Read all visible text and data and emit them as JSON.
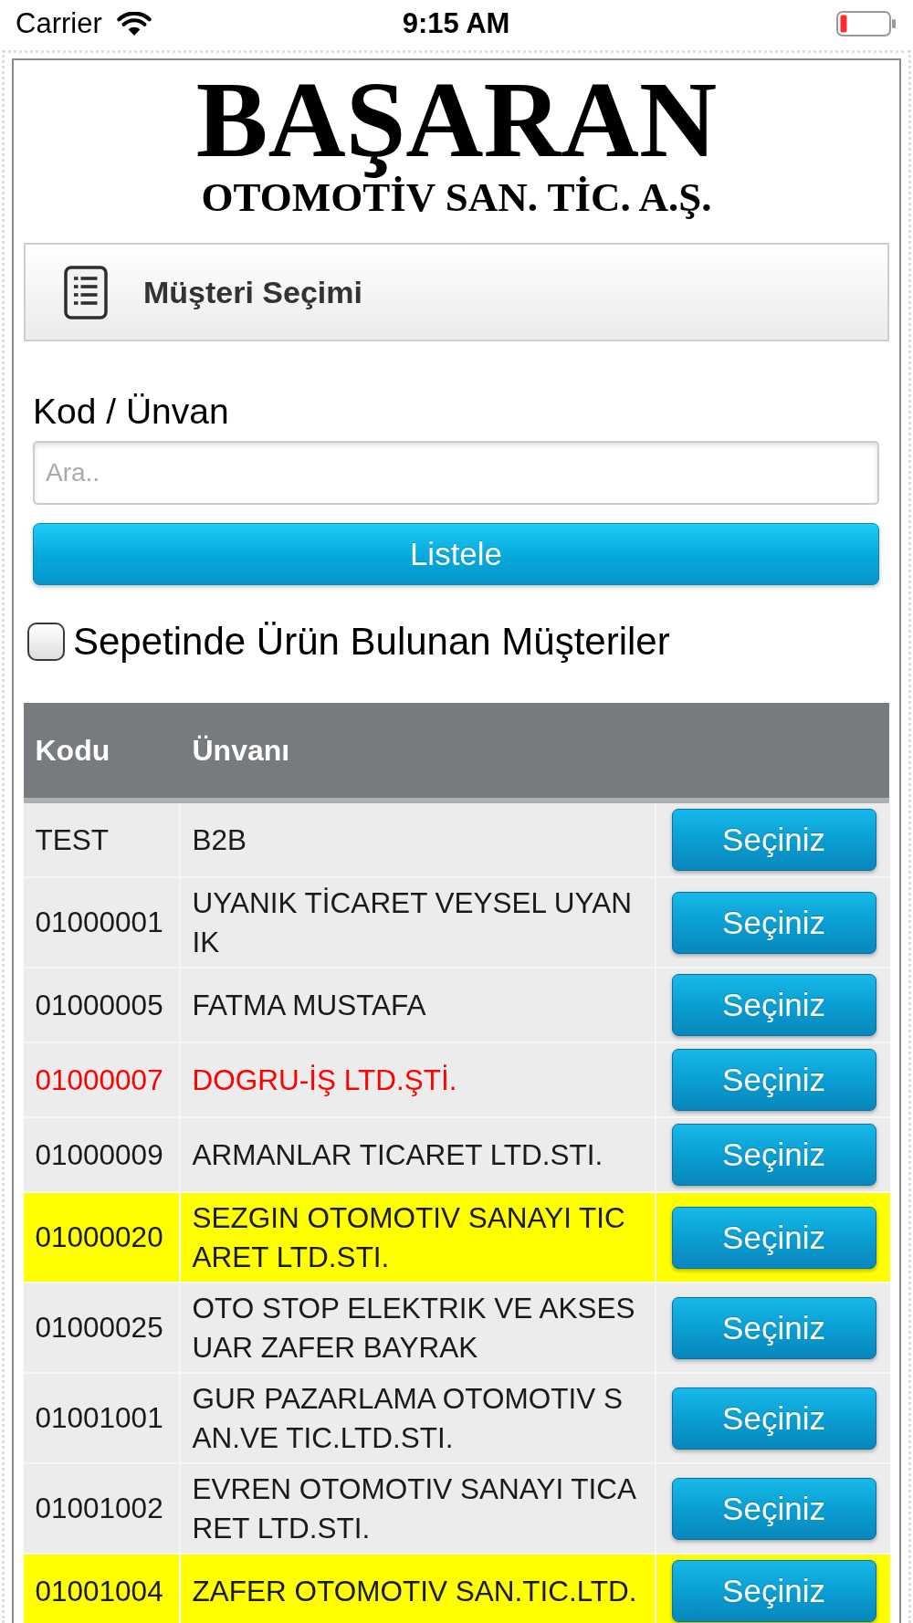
{
  "status_bar": {
    "carrier": "Carrier",
    "time": "9:15 AM"
  },
  "logo": {
    "title": "BAŞARAN",
    "subtitle": "OTOMOTİV SAN. TİC. A.Ş."
  },
  "panel": {
    "title": "Müşteri Seçimi"
  },
  "search": {
    "label": "Kod / Ünvan",
    "placeholder": "Ara..",
    "button": "Listele"
  },
  "filter": {
    "label": "Sepetinde Ürün Bulunan Müşteriler",
    "checked": false
  },
  "table": {
    "columns": [
      "Kodu",
      "Ünvanı"
    ],
    "rows": [
      {
        "code": "TEST",
        "name": "B2B",
        "button": "Seçiniz",
        "highlighted": false,
        "warning": false
      },
      {
        "code": "01000001",
        "name": "UYANIK TİCARET VEYSEL UYANIK",
        "button": "Seçiniz",
        "highlighted": false,
        "warning": false
      },
      {
        "code": "01000005",
        "name": "FATMA MUSTAFA",
        "button": "Seçiniz",
        "highlighted": false,
        "warning": false
      },
      {
        "code": "01000007",
        "name": "DOGRU-İŞ LTD.ŞTİ.",
        "button": "Seçiniz",
        "highlighted": false,
        "warning": true
      },
      {
        "code": "01000009",
        "name": "ARMANLAR TICARET LTD.STI.",
        "button": "Seçiniz",
        "highlighted": false,
        "warning": false
      },
      {
        "code": "01000020",
        "name": "SEZGIN OTOMOTIV SANAYI TICARET LTD.STI.",
        "button": "Seçiniz",
        "highlighted": true,
        "warning": false
      },
      {
        "code": "01000025",
        "name": "OTO STOP ELEKTRIK VE AKSESUAR ZAFER BAYRAK",
        "button": "Seçiniz",
        "highlighted": false,
        "warning": false
      },
      {
        "code": "01001001",
        "name": "GUR PAZARLAMA OTOMOTIV SAN.VE TIC.LTD.STI.",
        "button": "Seçiniz",
        "highlighted": false,
        "warning": false
      },
      {
        "code": "01001002",
        "name": "EVREN OTOMOTIV SANAYI TICARET LTD.STI.",
        "button": "Seçiniz",
        "highlighted": false,
        "warning": false
      },
      {
        "code": "01001004",
        "name": "ZAFER OTOMOTIV SAN.TIC.LTD.",
        "button": "Seçiniz",
        "highlighted": true,
        "warning": false
      }
    ]
  }
}
